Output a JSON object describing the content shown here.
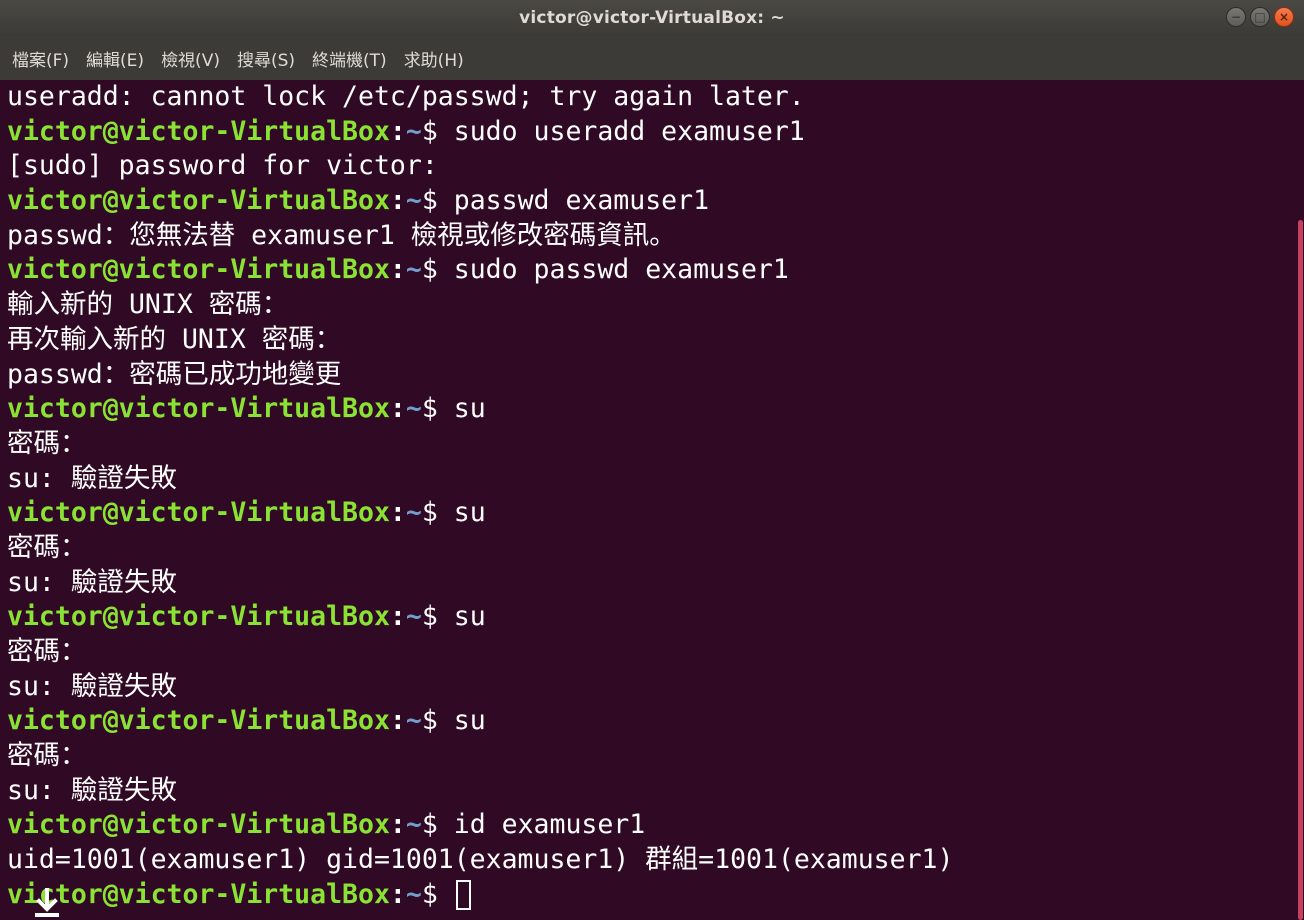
{
  "window": {
    "title": "victor@victor-VirtualBox: ~",
    "minimize_label": "−",
    "maximize_label": "□",
    "close_label": "×"
  },
  "menu": [
    "檔案(F)",
    "編輯(E)",
    "檢視(V)",
    "搜尋(S)",
    "終端機(T)",
    "求助(H)"
  ],
  "prompt": {
    "user_host": "victor@victor-VirtualBox",
    "colon": ":",
    "path": "~",
    "dollar": "$ "
  },
  "lines": [
    {
      "kind": "output",
      "text": "useradd: cannot lock /etc/passwd; try again later."
    },
    {
      "kind": "prompt",
      "text": "sudo useradd examuser1"
    },
    {
      "kind": "output",
      "text": "[sudo] password for victor:"
    },
    {
      "kind": "prompt",
      "text": "passwd examuser1"
    },
    {
      "kind": "output",
      "text": "passwd：您無法替 examuser1 檢視或修改密碼資訊。"
    },
    {
      "kind": "prompt",
      "text": "sudo passwd examuser1"
    },
    {
      "kind": "output",
      "text": "輸入新的 UNIX 密碼："
    },
    {
      "kind": "output",
      "text": "再次輸入新的 UNIX 密碼："
    },
    {
      "kind": "output",
      "text": "passwd：密碼已成功地變更"
    },
    {
      "kind": "prompt",
      "text": "su"
    },
    {
      "kind": "output",
      "text": "密碼："
    },
    {
      "kind": "output",
      "text": "su: 驗證失敗"
    },
    {
      "kind": "prompt",
      "text": "su"
    },
    {
      "kind": "output",
      "text": "密碼："
    },
    {
      "kind": "output",
      "text": "su: 驗證失敗"
    },
    {
      "kind": "prompt",
      "text": "su"
    },
    {
      "kind": "output",
      "text": "密碼："
    },
    {
      "kind": "output",
      "text": "su: 驗證失敗"
    },
    {
      "kind": "prompt",
      "text": "su"
    },
    {
      "kind": "output",
      "text": "密碼："
    },
    {
      "kind": "output",
      "text": "su: 驗證失敗"
    },
    {
      "kind": "prompt",
      "text": "id examuser1"
    },
    {
      "kind": "output",
      "text": "uid=1001(examuser1) gid=1001(examuser1) 群組=1001(examuser1)"
    },
    {
      "kind": "prompt",
      "text": ""
    }
  ],
  "colors": {
    "background": "#300a24",
    "prompt_user": "#8ae234",
    "prompt_path": "#729fcf",
    "text": "#ffffff",
    "scrollbar_thumb": "#c4425f"
  }
}
